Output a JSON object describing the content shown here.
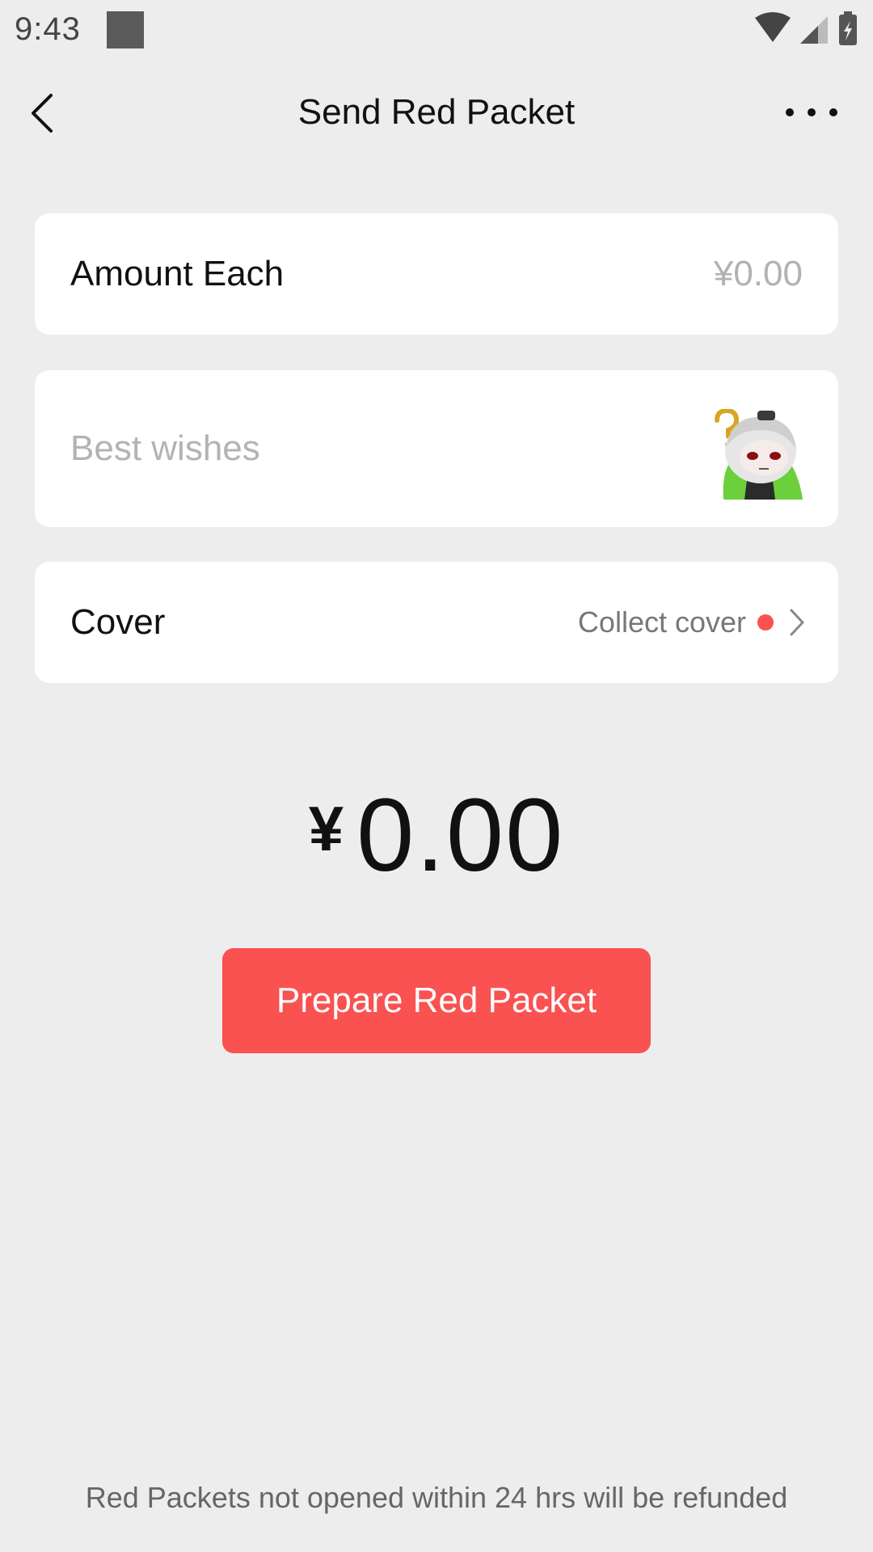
{
  "status_bar": {
    "time": "9:43",
    "icons": [
      "wifi-icon",
      "signal-icon",
      "battery-charging-icon"
    ]
  },
  "header": {
    "title": "Send Red Packet",
    "back_icon": "chevron-left-icon",
    "more_icon": "more-horizontal-icon"
  },
  "form": {
    "amount": {
      "label": "Amount Each",
      "placeholder": "¥0.00"
    },
    "wishes": {
      "placeholder": "Best wishes",
      "sticker_icon": "sticker-icon"
    },
    "cover": {
      "label": "Cover",
      "link_text": "Collect cover",
      "chevron_icon": "chevron-right-icon"
    }
  },
  "total": {
    "currency": "¥",
    "amount": "0.00"
  },
  "actions": {
    "prepare_label": "Prepare Red Packet"
  },
  "footer": {
    "note": "Red Packets not opened within 24 hrs will be refunded"
  },
  "colors": {
    "accent": "#fa5151",
    "background": "#ededed",
    "card": "#ffffff"
  }
}
